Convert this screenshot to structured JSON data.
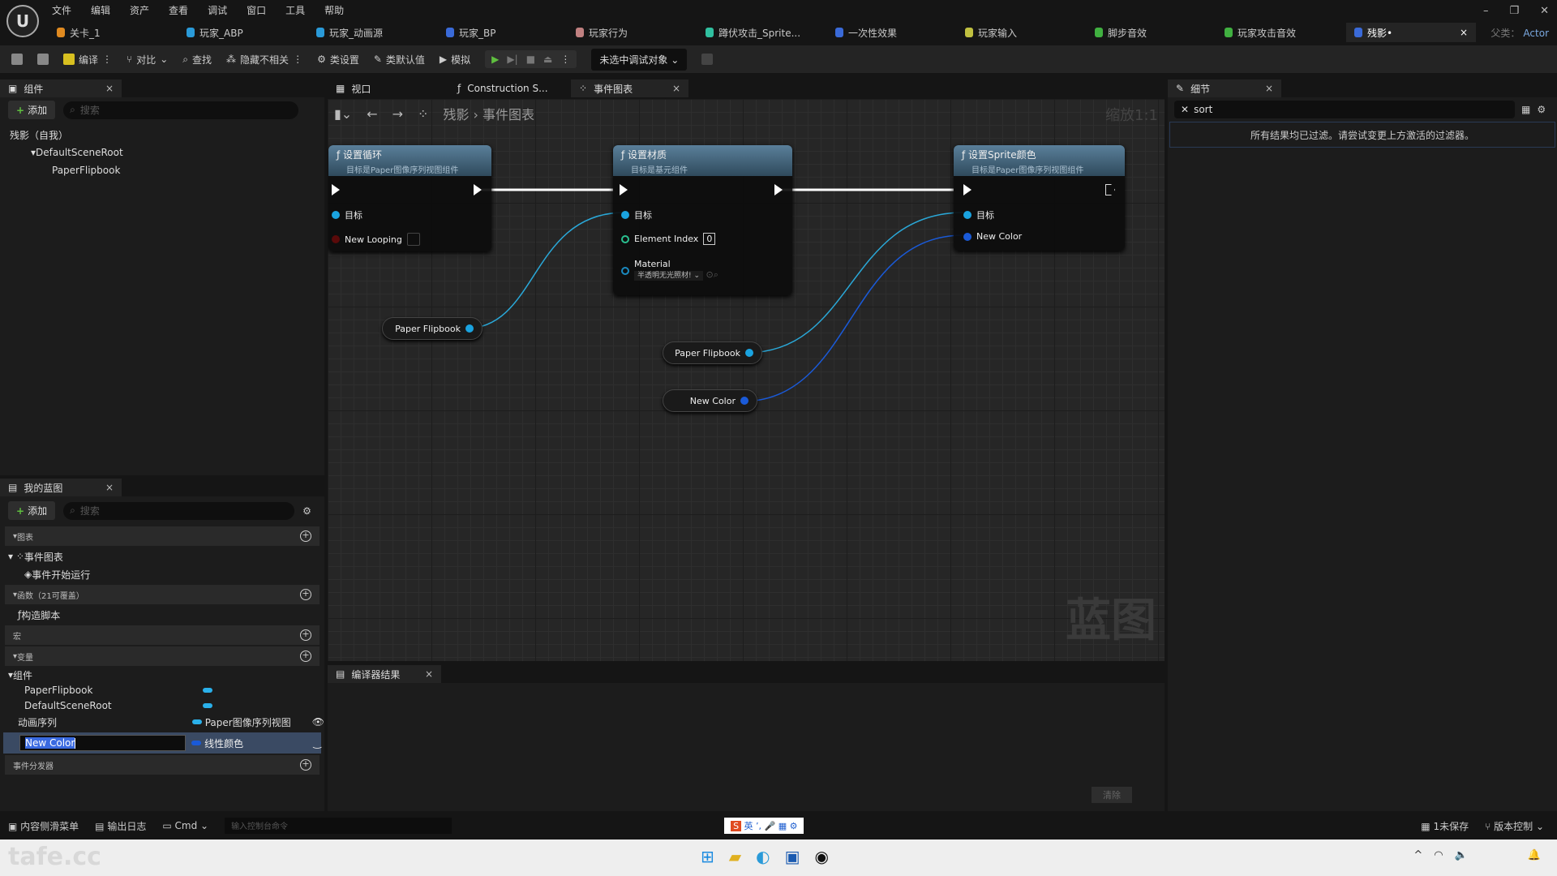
{
  "menu": [
    "文件",
    "编辑",
    "资产",
    "查看",
    "调试",
    "窗口",
    "工具",
    "帮助"
  ],
  "tabs": [
    {
      "label": "关卡_1",
      "color": "#e08a20"
    },
    {
      "label": "玩家_ABP",
      "color": "#2a9ad8"
    },
    {
      "label": "玩家_动画源",
      "color": "#2a9ad8"
    },
    {
      "label": "玩家_BP",
      "color": "#3a6ad8"
    },
    {
      "label": "玩家行为",
      "color": "#c08080"
    },
    {
      "label": "蹲伏攻击_Sprite...",
      "color": "#30c0a0"
    },
    {
      "label": "一次性效果",
      "color": "#3a6ad8"
    },
    {
      "label": "玩家输入",
      "color": "#c0c040"
    },
    {
      "label": "脚步音效",
      "color": "#40b040"
    },
    {
      "label": "玩家攻击音效",
      "color": "#40b040"
    },
    {
      "label": "残影•",
      "color": "#3a6ad8",
      "active": true
    }
  ],
  "parent_class": {
    "label": "父类：",
    "value": "Actor"
  },
  "toolbar": {
    "compile": "编译",
    "diff": "对比",
    "find": "查找",
    "hide_unrelated": "隐藏不相关",
    "class_settings": "类设置",
    "class_defaults": "类默认值",
    "simulate": "模拟",
    "debug_target": "未选中调试对象"
  },
  "components": {
    "tab": "组件",
    "add": "添加",
    "search_placeholder": "搜索",
    "root": "残影（自我）",
    "items": [
      "DefaultSceneRoot",
      "PaperFlipbook"
    ]
  },
  "graph_tabs": {
    "viewport": "视口",
    "construction": "Construction S...",
    "event_graph": "事件图表"
  },
  "breadcrumb": {
    "bp": "残影",
    "graph": "事件图表",
    "zoom": "缩放1:1"
  },
  "watermark": "蓝图",
  "nodes": [
    {
      "title": "设置循环",
      "subtitle": "目标是Paper图像序列视图组件",
      "pins": [
        "目标",
        "New Looping"
      ]
    },
    {
      "title": "设置材质",
      "subtitle": "目标是基元组件",
      "pins": [
        "目标",
        "Element Index",
        "Material"
      ],
      "element_index": "0",
      "material_value": "半透明无光照材!"
    },
    {
      "title": "设置Sprite颜色",
      "subtitle": "目标是Paper图像序列视图组件",
      "pins": [
        "目标",
        "New Color"
      ]
    }
  ],
  "var_nodes": [
    "Paper Flipbook",
    "Paper Flipbook",
    "New Color"
  ],
  "details": {
    "tab": "细节",
    "search_value": "sort",
    "message": "所有结果均已过滤。请尝试变更上方激活的过滤器。"
  },
  "my_blueprint": {
    "tab": "我的蓝图",
    "add": "添加",
    "search_placeholder": "搜索",
    "graphs": "图表",
    "event_graph": "事件图表",
    "begin_play": "事件开始运行",
    "functions": "函数（21可覆盖）",
    "construction_script": "构造脚本",
    "macros": "宏",
    "variables": "变量",
    "components_group": "组件",
    "comp_vars": [
      "PaperFlipbook",
      "DefaultSceneRoot"
    ],
    "var1": {
      "name": "动画序列",
      "type": "Paper图像序列视图"
    },
    "var2": {
      "name": "New Color",
      "type": "线性颜色"
    },
    "dispatchers": "事件分发器"
  },
  "compiler": {
    "tab": "编译器结果",
    "clear": "清除"
  },
  "status": {
    "content_drawer": "内容侧滑菜单",
    "output_log": "输出日志",
    "cmd": "Cmd",
    "cmd_placeholder": "输入控制台命令",
    "unsaved": "1未保存",
    "source_control": "版本控制"
  },
  "ime": {
    "lang": "英"
  },
  "overlay_watermark": "tafe.cc"
}
